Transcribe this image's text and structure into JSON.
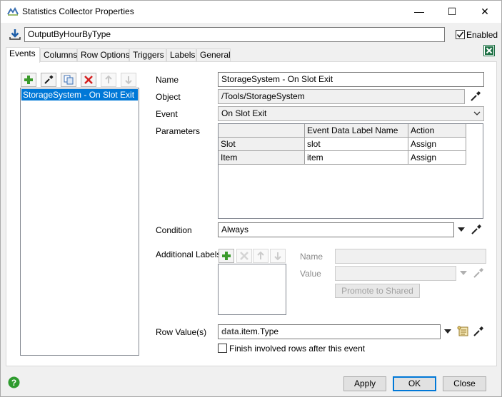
{
  "window": {
    "title": "Statistics Collector Properties",
    "minimize_glyph": "—",
    "maximize_glyph": "☐",
    "close_glyph": "✕"
  },
  "header": {
    "name_value": "OutputByHourByType",
    "enabled_label": "Enabled",
    "enabled_checked": true,
    "left_icon": "download-icon",
    "right_icon": "excel-icon"
  },
  "tabs": [
    {
      "label": "Events",
      "active": true
    },
    {
      "label": "Columns",
      "active": false
    },
    {
      "label": "Row Options",
      "active": false
    },
    {
      "label": "Triggers",
      "active": false
    },
    {
      "label": "Labels",
      "active": false
    },
    {
      "label": "General",
      "active": false
    }
  ],
  "events_list": {
    "toolbar_icons": [
      "add-icon",
      "eyedropper-icon",
      "copy-icon",
      "delete-icon",
      "move-up-icon",
      "move-down-icon"
    ],
    "items": [
      "StorageSystem - On Slot Exit"
    ],
    "selected_index": 0
  },
  "form": {
    "name_label": "Name",
    "name_value": "StorageSystem - On Slot Exit",
    "object_label": "Object",
    "object_value": "/Tools/StorageSystem",
    "event_label": "Event",
    "event_value": "On Slot Exit",
    "parameters_label": "Parameters",
    "parameters": {
      "columns": [
        "",
        "Event Data Label Name",
        "Action"
      ],
      "rows": [
        {
          "param": "Slot",
          "label_name": "slot",
          "action": "Assign"
        },
        {
          "param": "Item",
          "label_name": "item",
          "action": "Assign"
        }
      ]
    },
    "condition_label": "Condition",
    "condition_value": "Always",
    "additional_labels_label": "Additional Labels",
    "add_name_label": "Name",
    "add_value_label": "Value",
    "add_name_value": "",
    "add_value_value": "",
    "promote_button": "Promote to Shared",
    "row_values_label": "Row Value(s)",
    "row_values_prefix": "data",
    "row_values_suffix": ".item.Type",
    "finish_checkbox_label": "Finish involved rows after this event",
    "finish_checked": false
  },
  "footer": {
    "help_icon": "help-icon",
    "apply_label": "Apply",
    "ok_label": "OK",
    "close_label": "Close"
  },
  "colors": {
    "selection": "#0078d7",
    "window_bg": "#f0f0f0",
    "add_green": "#3a9a2b",
    "delete_red": "#d42020"
  }
}
